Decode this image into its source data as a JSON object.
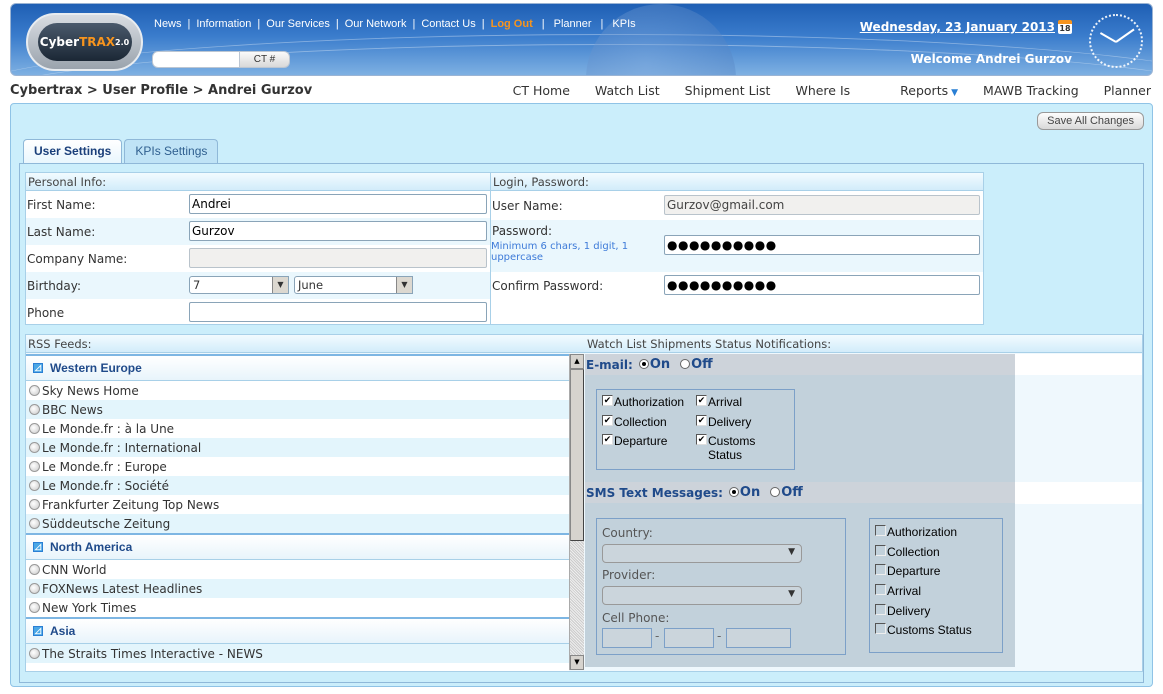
{
  "header": {
    "logo": {
      "part1": "Cyber",
      "part2": "TRAX",
      "version": "2.0"
    },
    "topnav": [
      {
        "label": "News"
      },
      {
        "label": "Information"
      },
      {
        "label": "Our Services"
      },
      {
        "label": "Our Network"
      },
      {
        "label": "Contact Us"
      },
      {
        "label": "Log Out"
      },
      {
        "label": "Planner"
      },
      {
        "label": "KPIs"
      }
    ],
    "ct_search": {
      "value": "",
      "button": "CT #"
    },
    "date": "Wednesday, 23 January 2013",
    "calendar_day": "18",
    "welcome": "Welcome Andrei Gurzov",
    "colors": {
      "accent": "#f7941d",
      "brand": "#2a6cc0"
    }
  },
  "breadcrumb": "Cybertrax > User Profile > Andrei Gurzov",
  "mainnav": [
    {
      "label": "CT Home"
    },
    {
      "label": "Watch List"
    },
    {
      "label": "Shipment List"
    },
    {
      "label": "Where Is"
    },
    {
      "label": "Reports"
    },
    {
      "label": "MAWB Tracking"
    },
    {
      "label": "Planner"
    }
  ],
  "save_all": "Save All Changes",
  "tabs": [
    {
      "label": "User Settings",
      "active": true
    },
    {
      "label": "KPIs Settings",
      "active": false
    }
  ],
  "personal": {
    "title": "Personal Info:",
    "first_name": {
      "label": "First Name:",
      "value": "Andrei"
    },
    "last_name": {
      "label": "Last Name:",
      "value": "Gurzov"
    },
    "company": {
      "label": "Company Name:",
      "value": ""
    },
    "birthday": {
      "label": "Birthday:",
      "day": "7",
      "month": "June"
    },
    "phone": {
      "label": "Phone",
      "value": ""
    }
  },
  "login": {
    "title": "Login, Password:",
    "username": {
      "label": "User Name:",
      "value": "Gurzov@gmail.com"
    },
    "password": {
      "label": "Password:",
      "hint": "Minimum 6 chars, 1 digit, 1 uppercase",
      "value": "●●●●●●●●●●"
    },
    "confirm": {
      "label": "Confirm Password:",
      "value": "●●●●●●●●●●"
    }
  },
  "rss": {
    "title": "RSS Feeds:",
    "groups": [
      {
        "name": "Western Europe",
        "items": [
          "Sky News Home",
          "BBC News",
          "Le Monde.fr : à la Une",
          "Le Monde.fr : International",
          "Le Monde.fr : Europe",
          "Le Monde.fr : Société",
          "Frankfurter Zeitung Top News",
          "Süddeutsche Zeitung"
        ]
      },
      {
        "name": "North America",
        "items": [
          "CNN World",
          "FOXNews Latest Headlines",
          "New York Times"
        ]
      },
      {
        "name": "Asia",
        "items": [
          "The Straits Times Interactive - NEWS"
        ]
      }
    ]
  },
  "notifications": {
    "title": "Watch List Shipments Status Notifications:",
    "email": {
      "label": "E-mail:",
      "on": "On",
      "off": "Off",
      "selected": "On",
      "options": [
        {
          "label": "Authorization",
          "checked": true
        },
        {
          "label": "Collection",
          "checked": true
        },
        {
          "label": "Departure",
          "checked": true
        },
        {
          "label": "Arrival",
          "checked": true
        },
        {
          "label": "Delivery",
          "checked": true
        },
        {
          "label": "Customs Status",
          "checked": true
        }
      ]
    },
    "sms": {
      "label": "SMS Text Messages:",
      "on": "On",
      "off": "Off",
      "selected": "On",
      "country_label": "Country:",
      "country_value": "",
      "provider_label": "Provider:",
      "provider_value": "",
      "cell_label": "Cell Phone:",
      "cell_parts": [
        "",
        "",
        ""
      ],
      "options": [
        {
          "label": "Authorization",
          "checked": false
        },
        {
          "label": "Collection",
          "checked": false
        },
        {
          "label": "Departure",
          "checked": false
        },
        {
          "label": "Arrival",
          "checked": false
        },
        {
          "label": "Delivery",
          "checked": false
        },
        {
          "label": "Customs Status",
          "checked": false
        }
      ]
    }
  }
}
